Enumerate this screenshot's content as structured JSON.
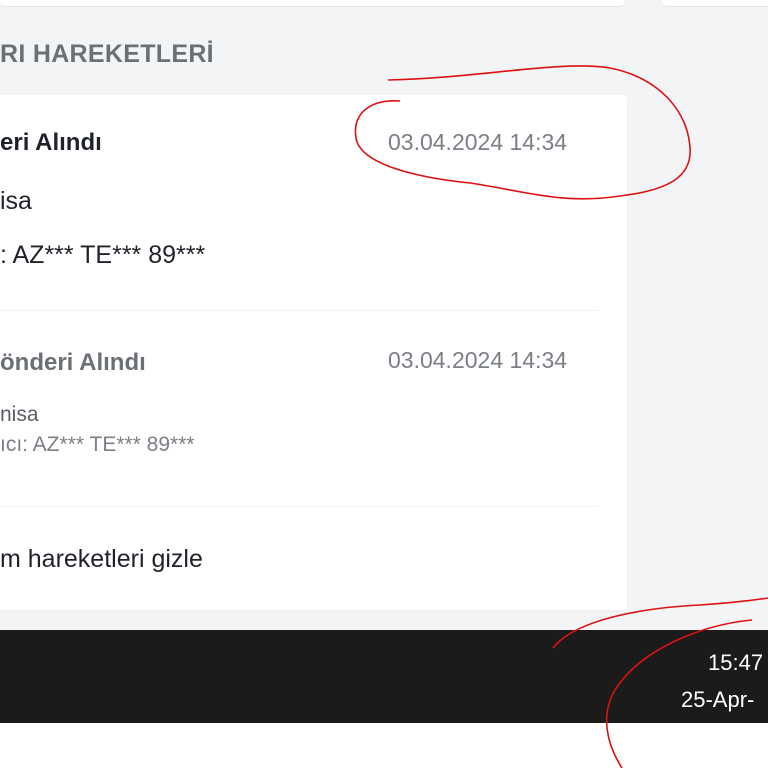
{
  "section": {
    "title": "RI HAREKETLERİ"
  },
  "events": [
    {
      "title": "eri Alındı",
      "date": "03.04.2024 14:34",
      "line1": "isa",
      "line2": ": AZ*** TE*** 89***"
    },
    {
      "title": "önderi Alındı",
      "date": "03.04.2024 14:34",
      "line1": "nisa",
      "line2": "ıcı: AZ*** TE*** 89***"
    }
  ],
  "toggle": {
    "label": "m hareketleri gizle"
  },
  "taskbar": {
    "time": "15:47",
    "date": "25-Apr-"
  },
  "colors": {
    "annotation": "#dd1111",
    "taskbar": "#1b1b1b",
    "card": "#ffffff",
    "page": "#f3f4f6"
  }
}
